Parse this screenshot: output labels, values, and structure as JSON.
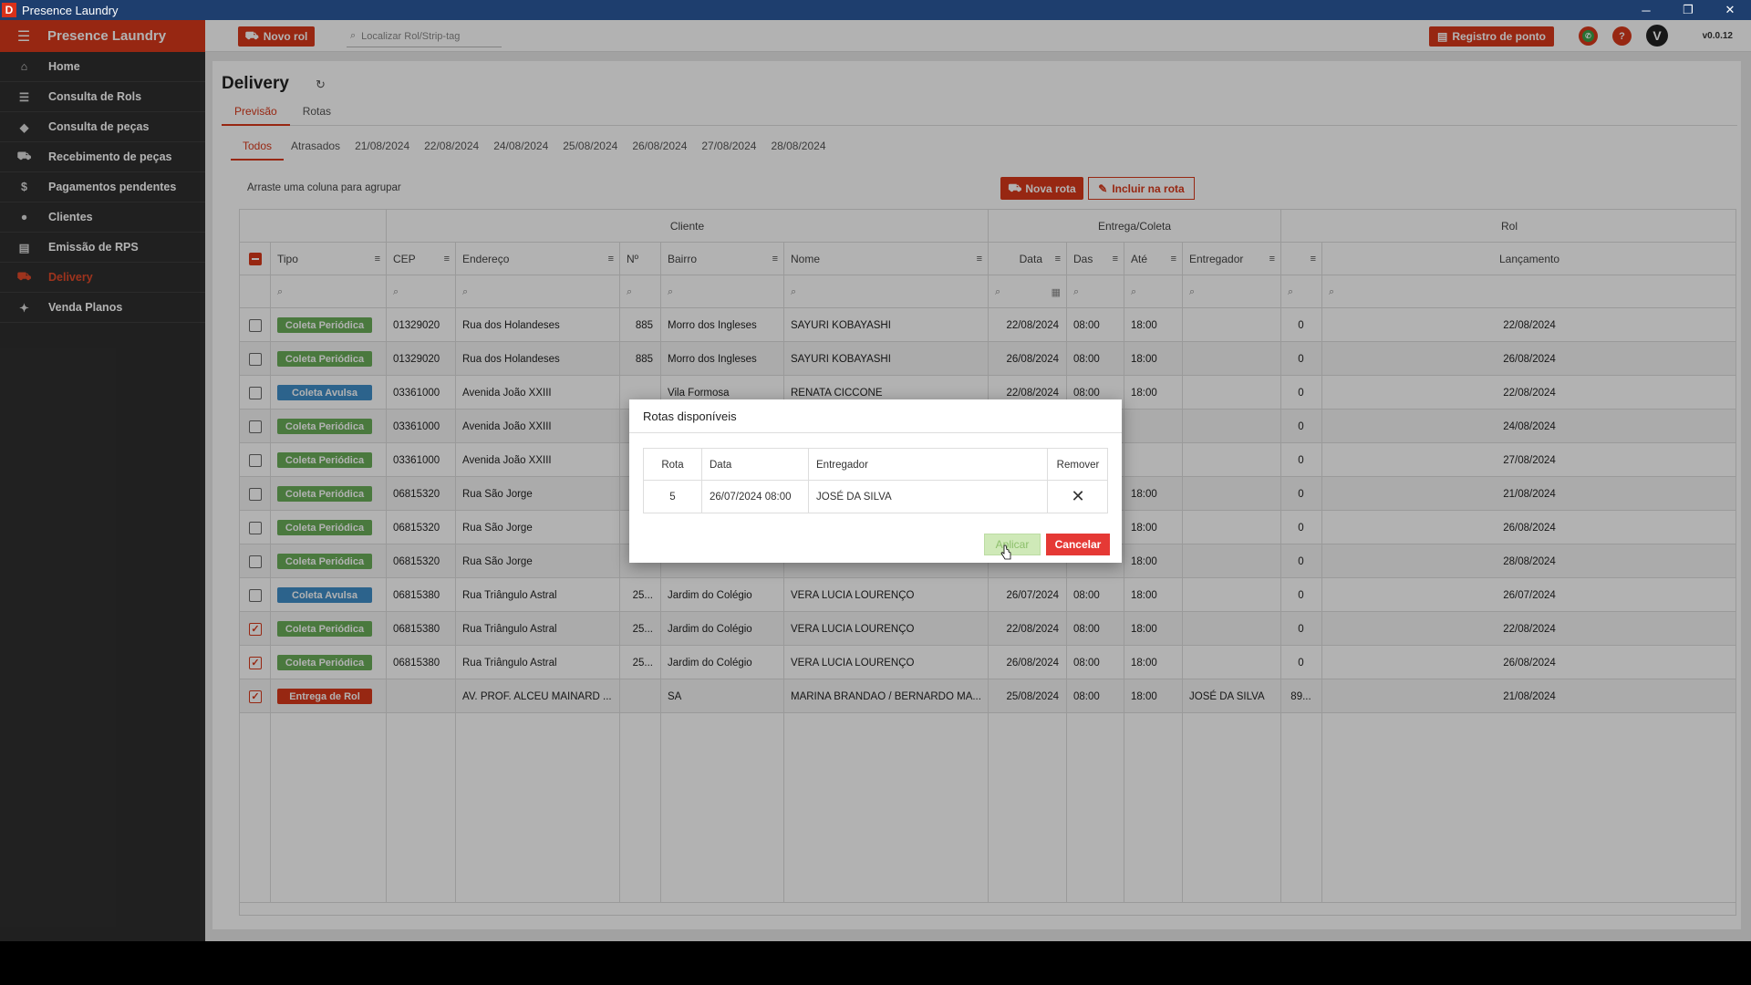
{
  "window": {
    "title": "Presence Laundry",
    "icon_letter": "D",
    "controls": [
      "─",
      "❐",
      "✕"
    ]
  },
  "sidebar": {
    "brand": "Presence Laundry",
    "items": [
      {
        "label": "Home",
        "icon": "home-icon",
        "glyph": "⌂",
        "active": false
      },
      {
        "label": "Consulta de Rols",
        "icon": "checklist-icon",
        "glyph": "☰",
        "active": false
      },
      {
        "label": "Consulta de peças",
        "icon": "tag-icon",
        "glyph": "◆",
        "active": false
      },
      {
        "label": "Recebimento de peças",
        "icon": "cart-icon",
        "glyph": "⛟",
        "active": false
      },
      {
        "label": "Pagamentos pendentes",
        "icon": "dollar-icon",
        "glyph": "$",
        "active": false
      },
      {
        "label": "Clientes",
        "icon": "person-icon",
        "glyph": "●",
        "active": false
      },
      {
        "label": "Emissão de RPS",
        "icon": "receipt-icon",
        "glyph": "▤",
        "active": false
      },
      {
        "label": "Delivery",
        "icon": "truck-icon",
        "glyph": "⛟",
        "active": true
      },
      {
        "label": "Venda Planos",
        "icon": "plans-icon",
        "glyph": "✦",
        "active": false
      }
    ]
  },
  "appbar": {
    "novo_rol": "Novo rol",
    "search_placeholder": "Localizar Rol/Strip-tag",
    "registro_ponto": "Registro de ponto",
    "avatar_letter": "V",
    "version": "v0.0.12"
  },
  "page": {
    "title": "Delivery",
    "tabs": [
      "Previsão",
      "Rotas"
    ],
    "active_tab": 0,
    "date_tabs": [
      "Todos",
      "Atrasados",
      "21/08/2024",
      "22/08/2024",
      "24/08/2024",
      "25/08/2024",
      "26/08/2024",
      "27/08/2024",
      "28/08/2024"
    ],
    "group_hint": "Arraste uma coluna para agrupar",
    "btn_nova_rota": "Nova rota",
    "btn_incluir": "Incluir na rota"
  },
  "grid": {
    "groups": {
      "cliente": "Cliente",
      "entrega": "Entrega/Coleta",
      "rol": "Rol"
    },
    "headers": {
      "tipo": "Tipo",
      "cep": "CEP",
      "endereco": "Endereço",
      "numero": "Nº",
      "bairro": "Bairro",
      "nome": "Nome",
      "data": "Data",
      "das": "Das",
      "ate": "Até",
      "entregador": "Entregador",
      "rol_num": "",
      "lancamento": "Lançamento"
    },
    "rows": [
      {
        "checked": false,
        "tipo": "Coleta Periódica",
        "tipo_color": "#6aae5a",
        "cep": "01329020",
        "endereco": "Rua dos Holandeses",
        "numero": "885",
        "bairro": "Morro dos Ingleses",
        "nome": "SAYURI KOBAYASHI",
        "data": "22/08/2024",
        "das": "08:00",
        "ate": "18:00",
        "entregador": "",
        "rol": "0",
        "lancamento": "22/08/2024"
      },
      {
        "checked": false,
        "tipo": "Coleta Periódica",
        "tipo_color": "#6aae5a",
        "cep": "01329020",
        "endereco": "Rua dos Holandeses",
        "numero": "885",
        "bairro": "Morro dos Ingleses",
        "nome": "SAYURI KOBAYASHI",
        "data": "26/08/2024",
        "das": "08:00",
        "ate": "18:00",
        "entregador": "",
        "rol": "0",
        "lancamento": "26/08/2024"
      },
      {
        "checked": false,
        "tipo": "Coleta Avulsa",
        "tipo_color": "#3f8ec9",
        "cep": "03361000",
        "endereco": "Avenida João XXIII",
        "numero": "",
        "bairro": "Vila Formosa",
        "nome": "RENATA CICCONE",
        "data": "22/08/2024",
        "das": "08:00",
        "ate": "18:00",
        "entregador": "",
        "rol": "0",
        "lancamento": "22/08/2024"
      },
      {
        "checked": false,
        "tipo": "Coleta Periódica",
        "tipo_color": "#6aae5a",
        "cep": "03361000",
        "endereco": "Avenida João XXIII",
        "numero": "",
        "bairro": "",
        "nome": "",
        "data": "",
        "das": "",
        "ate": "",
        "entregador": "",
        "rol": "0",
        "lancamento": "24/08/2024"
      },
      {
        "checked": false,
        "tipo": "Coleta Periódica",
        "tipo_color": "#6aae5a",
        "cep": "03361000",
        "endereco": "Avenida João XXIII",
        "numero": "",
        "bairro": "",
        "nome": "",
        "data": "",
        "das": "",
        "ate": "",
        "entregador": "",
        "rol": "0",
        "lancamento": "27/08/2024"
      },
      {
        "checked": false,
        "tipo": "Coleta Periódica",
        "tipo_color": "#6aae5a",
        "cep": "06815320",
        "endereco": "Rua São Jorge",
        "numero": "",
        "bairro": "",
        "nome": "",
        "data": "",
        "das": "",
        "ate": "18:00",
        "entregador": "",
        "rol": "0",
        "lancamento": "21/08/2024"
      },
      {
        "checked": false,
        "tipo": "Coleta Periódica",
        "tipo_color": "#6aae5a",
        "cep": "06815320",
        "endereco": "Rua São Jorge",
        "numero": "",
        "bairro": "",
        "nome": "",
        "data": "",
        "das": "",
        "ate": "18:00",
        "entregador": "",
        "rol": "0",
        "lancamento": "26/08/2024"
      },
      {
        "checked": false,
        "tipo": "Coleta Periódica",
        "tipo_color": "#6aae5a",
        "cep": "06815320",
        "endereco": "Rua São Jorge",
        "numero": "",
        "bairro": "",
        "nome": "",
        "data": "",
        "das": "",
        "ate": "18:00",
        "entregador": "",
        "rol": "0",
        "lancamento": "28/08/2024"
      },
      {
        "checked": false,
        "tipo": "Coleta Avulsa",
        "tipo_color": "#3f8ec9",
        "cep": "06815380",
        "endereco": "Rua Triângulo Astral",
        "numero": "25...",
        "bairro": "Jardim do Colégio",
        "nome": "VERA LUCIA LOURENÇO",
        "data": "26/07/2024",
        "das": "08:00",
        "ate": "18:00",
        "entregador": "",
        "rol": "0",
        "lancamento": "26/07/2024"
      },
      {
        "checked": true,
        "tipo": "Coleta Periódica",
        "tipo_color": "#6aae5a",
        "cep": "06815380",
        "endereco": "Rua Triângulo Astral",
        "numero": "25...",
        "bairro": "Jardim do Colégio",
        "nome": "VERA LUCIA LOURENÇO",
        "data": "22/08/2024",
        "das": "08:00",
        "ate": "18:00",
        "entregador": "",
        "rol": "0",
        "lancamento": "22/08/2024"
      },
      {
        "checked": true,
        "tipo": "Coleta Periódica",
        "tipo_color": "#6aae5a",
        "cep": "06815380",
        "endereco": "Rua Triângulo Astral",
        "numero": "25...",
        "bairro": "Jardim do Colégio",
        "nome": "VERA LUCIA LOURENÇO",
        "data": "26/08/2024",
        "das": "08:00",
        "ate": "18:00",
        "entregador": "",
        "rol": "0",
        "lancamento": "26/08/2024"
      },
      {
        "checked": true,
        "tipo": "Entrega de Rol",
        "tipo_color": "#d9391b",
        "cep": "",
        "endereco": "AV. PROF. ALCEU MAINARD ...",
        "numero": "",
        "bairro": "SA",
        "nome": "MARINA BRANDAO / BERNARDO MA...",
        "data": "25/08/2024",
        "das": "08:00",
        "ate": "18:00",
        "entregador": "JOSÉ DA SILVA",
        "rol": "89...",
        "lancamento": "21/08/2024"
      }
    ]
  },
  "modal": {
    "title": "Rotas disponíveis",
    "headers": {
      "rota": "Rota",
      "data": "Data",
      "entregador": "Entregador",
      "remover": "Remover"
    },
    "rows": [
      {
        "rota": "5",
        "data": "26/07/2024 08:00",
        "entregador": "JOSÉ DA SILVA"
      }
    ],
    "btn_aplicar": "Aplicar",
    "btn_cancelar": "Cancelar"
  }
}
